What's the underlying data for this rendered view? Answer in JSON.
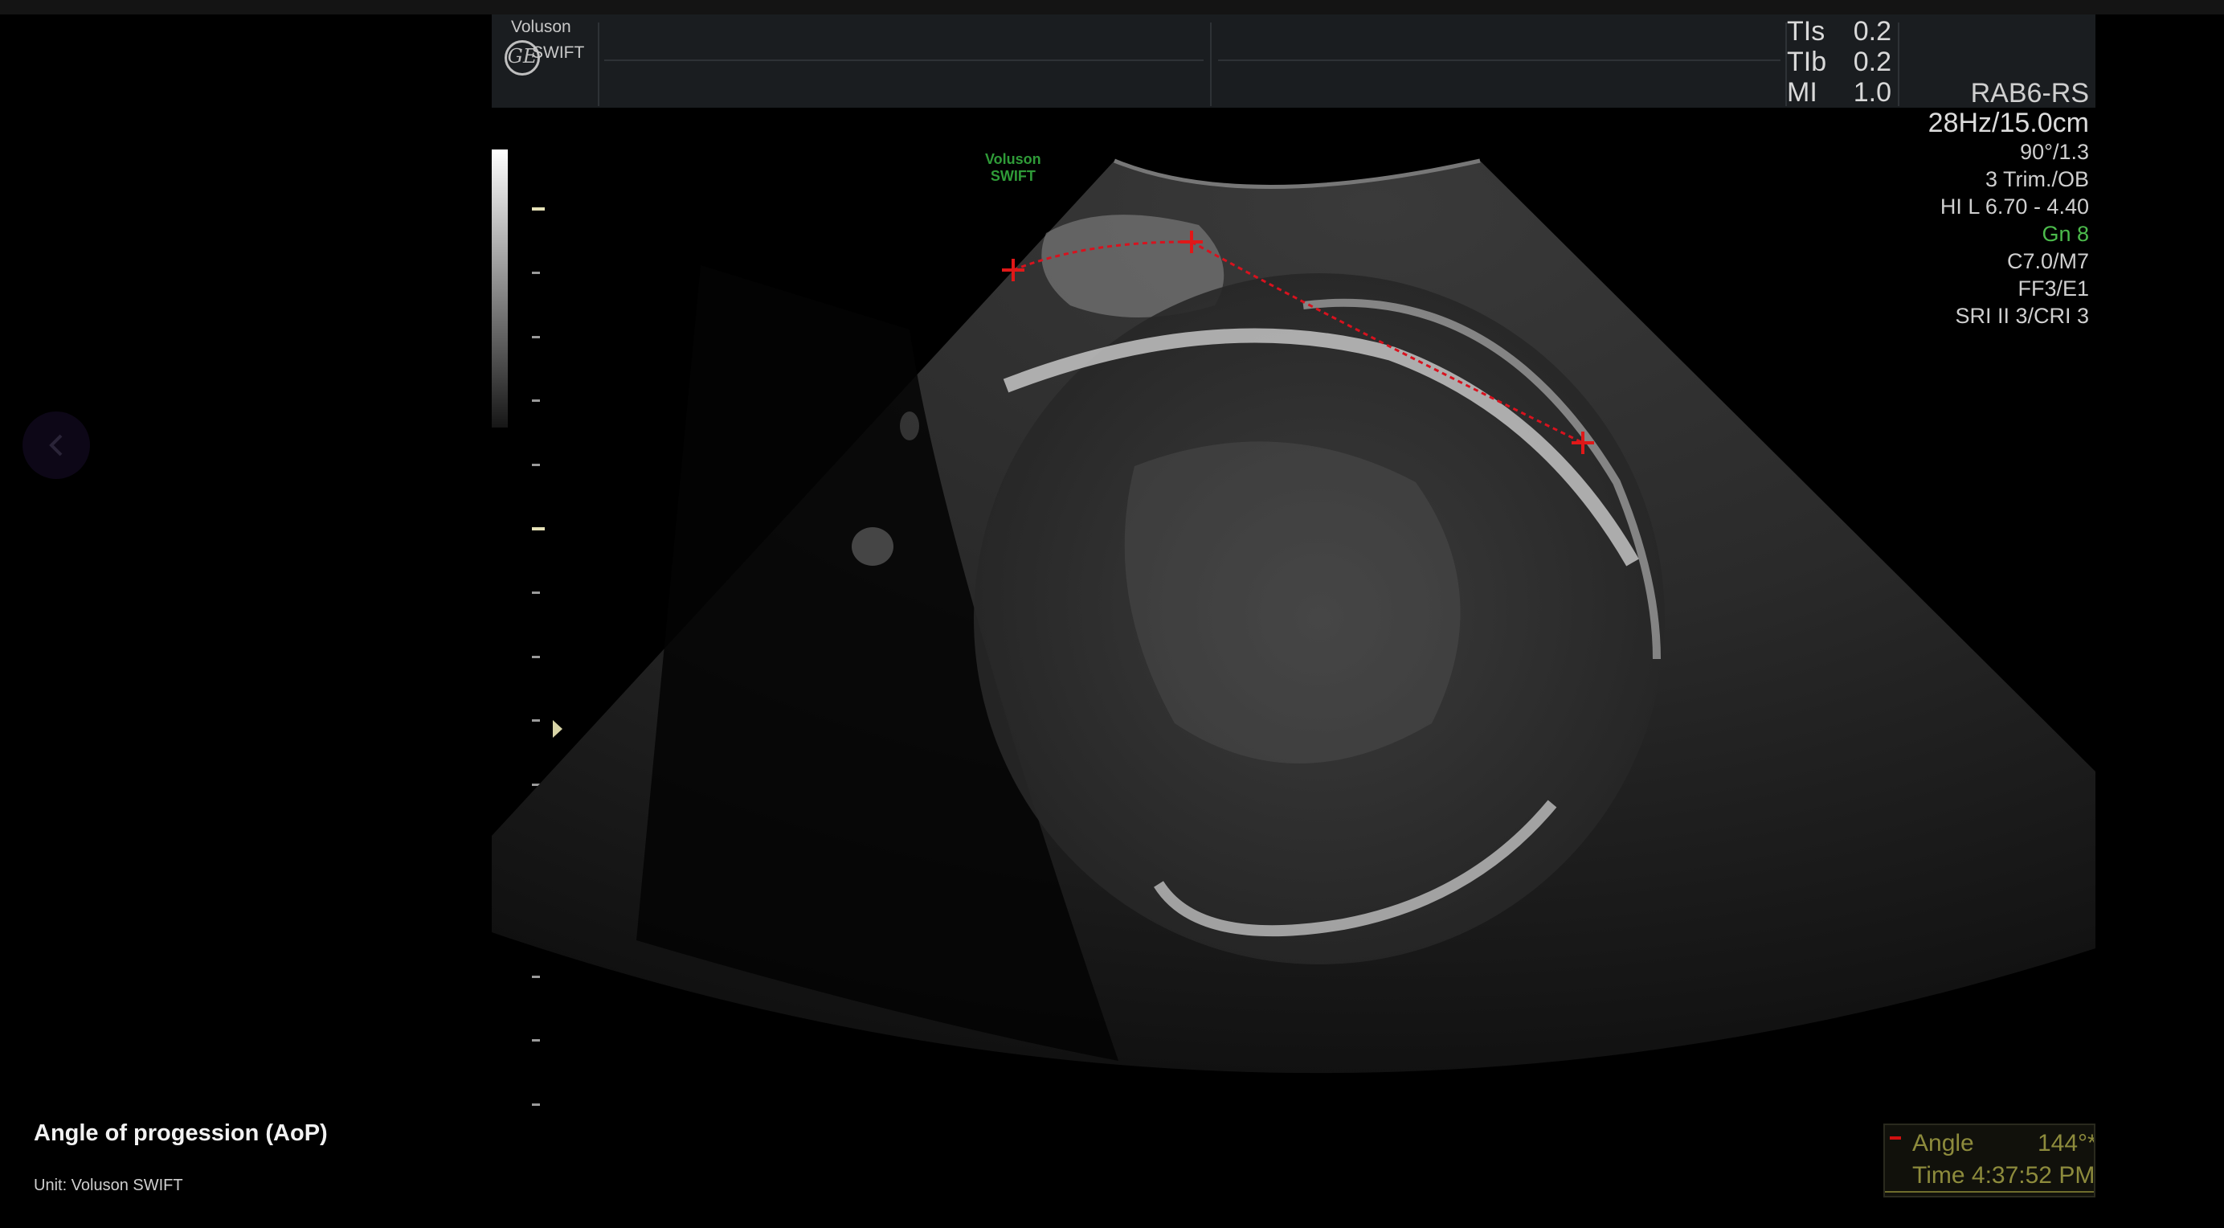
{
  "brand": {
    "line1": "Voluson",
    "line2": "SWIFT",
    "logo_text": "GE"
  },
  "safety": [
    {
      "label": "TIs",
      "value": "0.2"
    },
    {
      "label": "TIb",
      "value": "0.2"
    },
    {
      "label": "MI",
      "value": "1.0"
    }
  ],
  "params": {
    "probe": "RAB6-RS",
    "frame_depth": "28Hz/15.0cm",
    "angle_zoom": "90°/1.3",
    "preset": "3 Trim./OB",
    "frequency": "HI L  6.70 - 4.40",
    "gain": "Gn  8",
    "map": "C7.0/M7",
    "filter": "FF3/E1",
    "sri": "SRI II 3/CRI 3"
  },
  "image_watermark": {
    "line1": "Voluson",
    "line2": "SWIFT"
  },
  "caption": {
    "title": "Angle of progession (AoP)",
    "subtitle": "Unit: Voluson SWIFT"
  },
  "measurement": {
    "label": "Angle",
    "value": "144°*",
    "time": "Time 4:37:52 PM"
  },
  "icons": {
    "back": "chevron-left-icon",
    "caliper": "caliper-cross-icon",
    "logo": "ge-logo-icon"
  },
  "colors": {
    "caliper": "#e01818",
    "gain_text": "#4cbb4c",
    "watermark": "#2f9b38",
    "measurement_text": "#8d8b3c"
  }
}
